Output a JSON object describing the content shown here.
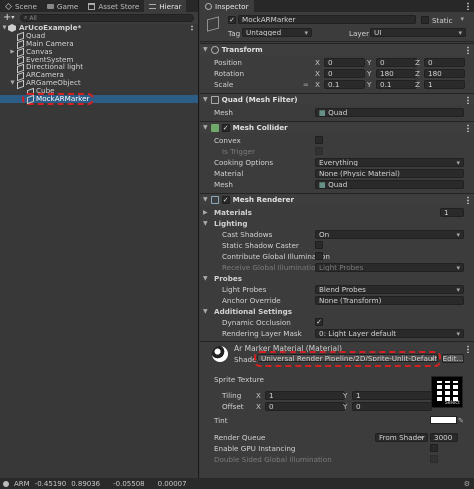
{
  "tabs": {
    "scene": "Scene",
    "game": "Game",
    "asset_store": "Asset Store",
    "hierarchy": "Hierar",
    "inspector": "Inspector"
  },
  "hierarchy": {
    "search_placeholder": "All",
    "items": [
      {
        "label": "ArUcoExample*",
        "depth": 0,
        "expanded": true,
        "type": "scene"
      },
      {
        "label": "Quad",
        "depth": 1,
        "type": "object"
      },
      {
        "label": "Main Camera",
        "depth": 1,
        "type": "object"
      },
      {
        "label": "Canvas",
        "depth": 1,
        "type": "object",
        "collapsed": true
      },
      {
        "label": "EventSystem",
        "depth": 1,
        "type": "object"
      },
      {
        "label": "Directional light",
        "depth": 1,
        "type": "object"
      },
      {
        "label": "ARCamera",
        "depth": 1,
        "type": "object"
      },
      {
        "label": "ARGameObject",
        "depth": 1,
        "expanded": true,
        "type": "object"
      },
      {
        "label": "Cube",
        "depth": 2,
        "type": "object"
      },
      {
        "label": "MockARMarker",
        "depth": 2,
        "type": "object",
        "selected": true
      }
    ]
  },
  "status": {
    "prefix": "ARM",
    "values": [
      "-0.45190",
      "0.89036",
      "-0.05508",
      "0.00007"
    ]
  },
  "inspector": {
    "object_name": "MockARMarker",
    "static_label": "Static",
    "tag_label": "Tag",
    "tag_value": "Untagged",
    "layer_label": "Layer",
    "layer_value": "UI",
    "transform": {
      "title": "Transform",
      "position": {
        "label": "Position",
        "x": "0",
        "y": "0",
        "z": "0"
      },
      "rotation": {
        "label": "Rotation",
        "x": "0",
        "y": "180",
        "z": "180"
      },
      "scale": {
        "label": "Scale",
        "x": "0.1",
        "y": "0.1",
        "z": "1"
      }
    },
    "mesh_filter": {
      "title": "Quad (Mesh Filter)",
      "mesh_label": "Mesh",
      "mesh_value": "Quad"
    },
    "mesh_collider": {
      "title": "Mesh Collider",
      "convex": "Convex",
      "is_trigger": "Is Trigger",
      "cooking_label": "Cooking Options",
      "cooking_value": "Everything",
      "material_label": "Material",
      "material_value": "None (Physic Material)",
      "mesh_label": "Mesh",
      "mesh_value": "Quad"
    },
    "mesh_renderer": {
      "title": "Mesh Renderer",
      "materials_label": "Materials",
      "materials_count": "1",
      "lighting": "Lighting",
      "cast_shadows": "Cast Shadows",
      "cast_shadows_value": "On",
      "static_caster": "Static Shadow Caster",
      "contribute_gi": "Contribute Global Illumination",
      "receive_gi": "Receive Global Illumination",
      "receive_gi_value": "Light Probes",
      "probes": "Probes",
      "light_probes": "Light Probes",
      "light_probes_value": "Blend Probes",
      "anchor_override": "Anchor Override",
      "anchor_override_value": "None (Transform)",
      "additional": "Additional Settings",
      "dynamic_occlusion": "Dynamic Occlusion",
      "rendering_layer_mask": "Rendering Layer Mask",
      "rendering_layer_mask_value": "0: Light Layer default"
    },
    "material": {
      "title": "Ar Marker Material (Material)",
      "shader_label": "Shader",
      "shader_value": "Universal Render Pipeline/2D/Sprite-Unlit-Default",
      "edit_label": "Edit...",
      "sprite_texture": "Sprite Texture",
      "tiling": "Tiling",
      "tiling_x": "1",
      "tiling_y": "1",
      "offset": "Offset",
      "offset_x": "0",
      "offset_y": "0",
      "select": "Select",
      "tint": "Tint",
      "render_queue": "Render Queue",
      "render_queue_mode": "From Shader",
      "render_queue_value": "3000",
      "gpu_instancing": "Enable GPU Instancing",
      "double_sided_gi": "Double Sided Global Illumination"
    }
  },
  "colors": {
    "selection": "#2c5d87",
    "highlight": "#d42020"
  }
}
